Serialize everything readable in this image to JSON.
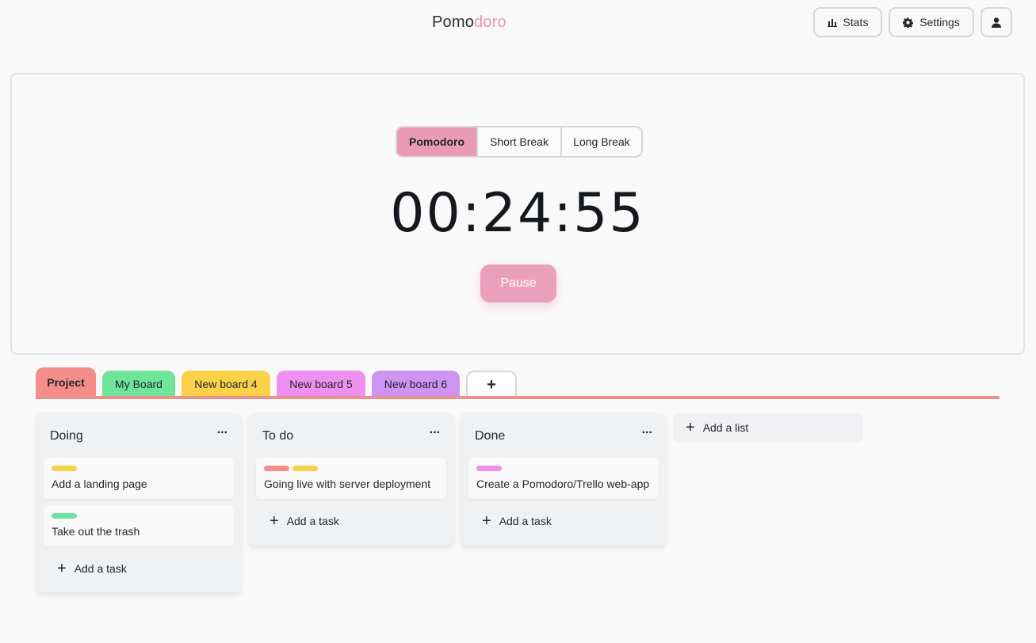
{
  "header": {
    "brand_part1": "Pomo",
    "brand_part2": "doro",
    "stats_label": "Stats",
    "settings_label": "Settings"
  },
  "timer": {
    "modes": [
      "Pomodoro",
      "Short Break",
      "Long Break"
    ],
    "active_mode": "Pomodoro",
    "time": "00:24:55",
    "pause_label": "Pause"
  },
  "boards": {
    "tabs": [
      {
        "label": "Project",
        "color": "#f58e8a",
        "active": true
      },
      {
        "label": "My Board",
        "color": "#6ee59a",
        "active": false
      },
      {
        "label": "New board 4",
        "color": "#f9d24a",
        "active": false
      },
      {
        "label": "New board 5",
        "color": "#ee90ef",
        "active": false
      },
      {
        "label": "New board 6",
        "color": "#cf93f2",
        "active": false
      }
    ],
    "add_tab_label": "+",
    "active_color": "#f08f89"
  },
  "lists": [
    {
      "title": "Doing",
      "menu": "...",
      "cards": [
        {
          "text": "Add a landing page",
          "labels": [
            "#f9d24a"
          ]
        },
        {
          "text": "Take out the trash",
          "labels": [
            "#6ee59a"
          ]
        }
      ],
      "add_task_label": "Add a task"
    },
    {
      "title": "To do",
      "menu": "...",
      "cards": [
        {
          "text": "Going live with server deployment",
          "labels": [
            "#f58e8a",
            "#f9d24a"
          ]
        }
      ],
      "add_task_label": "Add a task"
    },
    {
      "title": "Done",
      "menu": "...",
      "cards": [
        {
          "text": "Create a Pomodoro/Trello web-app",
          "labels": [
            "#ee90ef"
          ]
        }
      ],
      "add_task_label": "Add a task"
    }
  ],
  "add_list_label": "Add a list",
  "colors": {
    "accent_pink": "#e99bb6",
    "pause_pink": "#eaa0bb",
    "background": "#f9f9fa"
  }
}
